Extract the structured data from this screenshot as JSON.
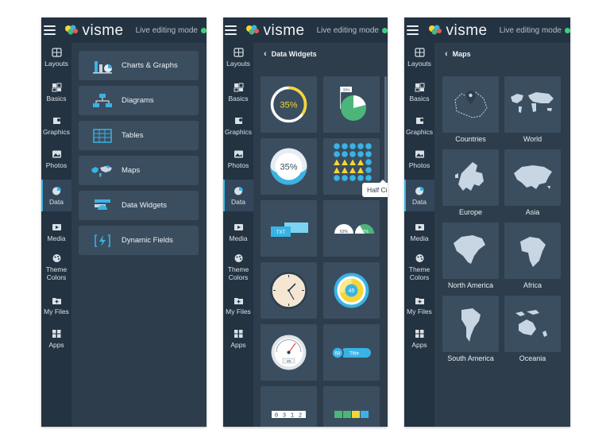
{
  "brand": {
    "name": "visme",
    "live_mode": "Live editing mode"
  },
  "sidenav": [
    {
      "label": "Layouts",
      "icon": "layouts-icon"
    },
    {
      "label": "Basics",
      "icon": "basics-icon"
    },
    {
      "label": "Graphics",
      "icon": "graphics-icon"
    },
    {
      "label": "Photos",
      "icon": "photos-icon"
    },
    {
      "label": "Data",
      "icon": "data-icon",
      "active": true
    },
    {
      "label": "Media",
      "icon": "media-icon"
    },
    {
      "label": "Theme Colors",
      "icon": "theme-colors-icon"
    },
    {
      "label": "My Files",
      "icon": "my-files-icon"
    },
    {
      "label": "Apps",
      "icon": "apps-icon"
    }
  ],
  "library": {
    "items": [
      {
        "label": "Charts & Graphs",
        "icon": "chart-icon"
      },
      {
        "label": "Diagrams",
        "icon": "diagram-icon"
      },
      {
        "label": "Tables",
        "icon": "table-icon"
      },
      {
        "label": "Maps",
        "icon": "map-icon"
      },
      {
        "label": "Data Widgets",
        "icon": "widget-icon"
      },
      {
        "label": "Dynamic Fields",
        "icon": "dynamic-field-icon"
      }
    ]
  },
  "widgets": {
    "title": "Data Widgets",
    "tooltip": "Half Circle",
    "tiles": [
      {
        "name": "radial-progress-widget",
        "value_text": "35%",
        "value": 0.35
      },
      {
        "name": "flag-pie-widget",
        "value_text": "33%"
      },
      {
        "name": "percentage-circle-widget",
        "value_text": "35%"
      },
      {
        "name": "icon-array-widget"
      },
      {
        "name": "text-blocks-widget",
        "value_text": "TXT"
      },
      {
        "name": "half-circle-widget",
        "left_text": "62%",
        "right_text": "27%"
      },
      {
        "name": "clock-widget"
      },
      {
        "name": "donut-gauge-widget",
        "value_text": "45"
      },
      {
        "name": "speedometer-widget",
        "value_text": "45"
      },
      {
        "name": "number-title-widget",
        "number": "68",
        "title": "Title"
      },
      {
        "name": "counter-widget",
        "digits": [
          "0",
          "3",
          "1",
          "2"
        ]
      },
      {
        "name": "color-bar-widget"
      }
    ]
  },
  "maps": {
    "title": "Maps",
    "items": [
      {
        "label": "Countries",
        "icon": "countries-map-icon"
      },
      {
        "label": "World",
        "icon": "world-map-icon"
      },
      {
        "label": "Europe",
        "icon": "europe-map-icon"
      },
      {
        "label": "Asia",
        "icon": "asia-map-icon"
      },
      {
        "label": "North America",
        "icon": "north-america-map-icon"
      },
      {
        "label": "Africa",
        "icon": "africa-map-icon"
      },
      {
        "label": "South America",
        "icon": "south-america-map-icon"
      },
      {
        "label": "Oceania",
        "icon": "oceania-map-icon"
      }
    ]
  },
  "colors": {
    "panel_bg": "#2d3d4c",
    "nav_bg": "#243341",
    "tile_bg": "#3b4e5f",
    "accent_blue": "#39b3e6",
    "accent_yellow": "#f5d638",
    "accent_green": "#4cb57a",
    "live_dot": "#3fcf7c"
  }
}
